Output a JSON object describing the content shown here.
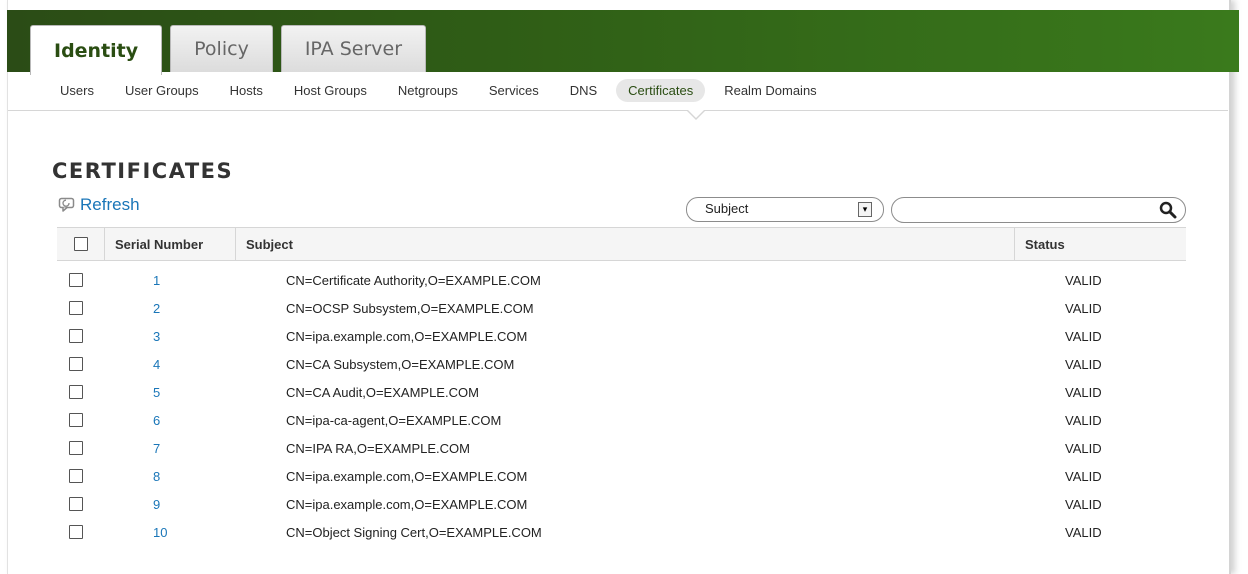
{
  "top_tabs": [
    {
      "label": "Identity",
      "active": true
    },
    {
      "label": "Policy",
      "active": false
    },
    {
      "label": "IPA Server",
      "active": false
    }
  ],
  "sub_nav": [
    {
      "label": "Users",
      "active": false
    },
    {
      "label": "User Groups",
      "active": false
    },
    {
      "label": "Hosts",
      "active": false
    },
    {
      "label": "Host Groups",
      "active": false
    },
    {
      "label": "Netgroups",
      "active": false
    },
    {
      "label": "Services",
      "active": false
    },
    {
      "label": "DNS",
      "active": false
    },
    {
      "label": "Certificates",
      "active": true
    },
    {
      "label": "Realm Domains",
      "active": false
    }
  ],
  "page": {
    "title": "CERTIFICATES",
    "refresh_label": "Refresh"
  },
  "filter": {
    "selected": "Subject",
    "search_value": "",
    "search_placeholder": ""
  },
  "table": {
    "columns": [
      "Serial Number",
      "Subject",
      "Status"
    ],
    "rows": [
      {
        "serial": "1",
        "subject": "CN=Certificate Authority,O=EXAMPLE.COM",
        "status": "VALID"
      },
      {
        "serial": "2",
        "subject": "CN=OCSP Subsystem,O=EXAMPLE.COM",
        "status": "VALID"
      },
      {
        "serial": "3",
        "subject": "CN=ipa.example.com,O=EXAMPLE.COM",
        "status": "VALID"
      },
      {
        "serial": "4",
        "subject": "CN=CA Subsystem,O=EXAMPLE.COM",
        "status": "VALID"
      },
      {
        "serial": "5",
        "subject": "CN=CA Audit,O=EXAMPLE.COM",
        "status": "VALID"
      },
      {
        "serial": "6",
        "subject": "CN=ipa-ca-agent,O=EXAMPLE.COM",
        "status": "VALID"
      },
      {
        "serial": "7",
        "subject": "CN=IPA RA,O=EXAMPLE.COM",
        "status": "VALID"
      },
      {
        "serial": "8",
        "subject": "CN=ipa.example.com,O=EXAMPLE.COM",
        "status": "VALID"
      },
      {
        "serial": "9",
        "subject": "CN=ipa.example.com,O=EXAMPLE.COM",
        "status": "VALID"
      },
      {
        "serial": "10",
        "subject": "CN=Object Signing Cert,O=EXAMPLE.COM",
        "status": "VALID"
      }
    ]
  },
  "colors": {
    "header_green_dark": "#2b4c16",
    "header_green_light": "#3a7a1c",
    "link_blue": "#1a76b8",
    "active_tab_text": "#2a4d12"
  },
  "icons": {
    "refresh": "refresh-icon",
    "search": "search-icon",
    "dropdown": "chevron-down-icon"
  }
}
